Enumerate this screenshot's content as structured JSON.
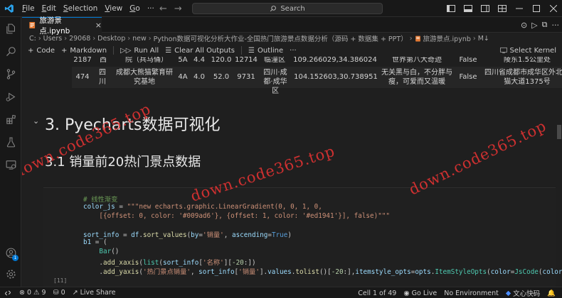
{
  "titlebar": {
    "menus": [
      {
        "mnemonic": "F",
        "rest": "ile"
      },
      {
        "mnemonic": "E",
        "rest": "dit"
      },
      {
        "mnemonic": "S",
        "rest": "election"
      },
      {
        "mnemonic": "V",
        "rest": "iew"
      },
      {
        "mnemonic": "G",
        "rest": "o"
      }
    ],
    "more": "···",
    "search_placeholder": "Search"
  },
  "tab": {
    "name": "旅游景点.ipynb"
  },
  "breadcrumb": [
    "C:",
    "Users",
    "29068",
    "Desktop",
    "new",
    "Python数据可视化分析大作业-全国热门旅游景点数据分析（源码 + 数据集 + PPT）",
    "旅游景点.ipynb",
    "M↓"
  ],
  "toolbar": {
    "code": "Code",
    "markdown": "Markdown",
    "run_all": "Run All",
    "clear_outputs": "Clear All Outputs",
    "outline": "Outline",
    "more": "···",
    "select_kernel": "Select Kernel"
  },
  "table_rows": [
    {
      "idx": "2187",
      "prov": "西",
      "name": "院（兵马俑）",
      "level": "5A",
      "score": "4.4",
      "price": "120.0",
      "sales": "12714",
      "area": "临潼区",
      "coord": "109.266029,34.386024",
      "desc": "世界第八大奇迹",
      "flag": "False",
      "addr": "陵东1.5公里处"
    },
    {
      "idx": "474",
      "prov": "四川",
      "name": "成都大熊猫繁育研究基地",
      "level": "4A",
      "score": "4.0",
      "price": "52.0",
      "sales": "9731",
      "area": "四川·成都·成华区",
      "coord": "104.152603,30.738951",
      "desc": "无关黑与白，不分胖与瘦，可爱而又温暖",
      "flag": "False",
      "addr": "四川省成都市成华区外北熊猫大道1375号"
    }
  ],
  "headings": {
    "h1": "3. Pyecharts数据可视化",
    "h2": "3.1 销量前20热门景点数据"
  },
  "code": {
    "line1_comment": "# 线性渐变",
    "line2": [
      "color_js",
      " = ",
      "\"\"\"new echarts.graphic.LinearGradient(0, 0, 1, 0,"
    ],
    "line3": "    [{offset: 0, color: '#009ad6'}, {offset: 1, color: '#ed1941'}], false)\"\"\"",
    "line4": [
      "sort_info",
      " = ",
      "df",
      ".",
      "sort_values",
      "(",
      "by",
      "=",
      "'销量'",
      ", ",
      "ascending",
      "=",
      "True",
      ")"
    ],
    "line5": [
      "b1",
      " = ("
    ],
    "line6": [
      "    ",
      "Bar",
      "()"
    ],
    "line7": [
      "    .",
      "add_xaxis",
      "(",
      "list",
      "(",
      "sort_info",
      "[",
      "'名称'",
      "][",
      "-20",
      ":])"
    ],
    "line8": [
      "    .",
      "add_yaxis",
      "(",
      "'热门景点销量'",
      ", ",
      "sort_info",
      "[",
      "'销量'",
      "].",
      "values",
      ".",
      "tolist",
      "()[",
      "-20",
      ":],",
      "itemstyle_opts",
      "=",
      "opts",
      ".",
      "ItemStyleOpts",
      "(",
      "color",
      "=",
      "JsCode",
      "(",
      "color_js",
      ")))"
    ],
    "exec_count": "[11]"
  },
  "watermarks": [
    "down.code365.top",
    "down.code365.top",
    "down.code365.top"
  ],
  "statusbar": {
    "errors": "0",
    "warnings": "9",
    "ports": "0",
    "live_share": "Live Share",
    "cell": "Cell 1 of 49",
    "go_live": "Go Live",
    "env": "No Environment",
    "wenxin": "文心快码"
  }
}
